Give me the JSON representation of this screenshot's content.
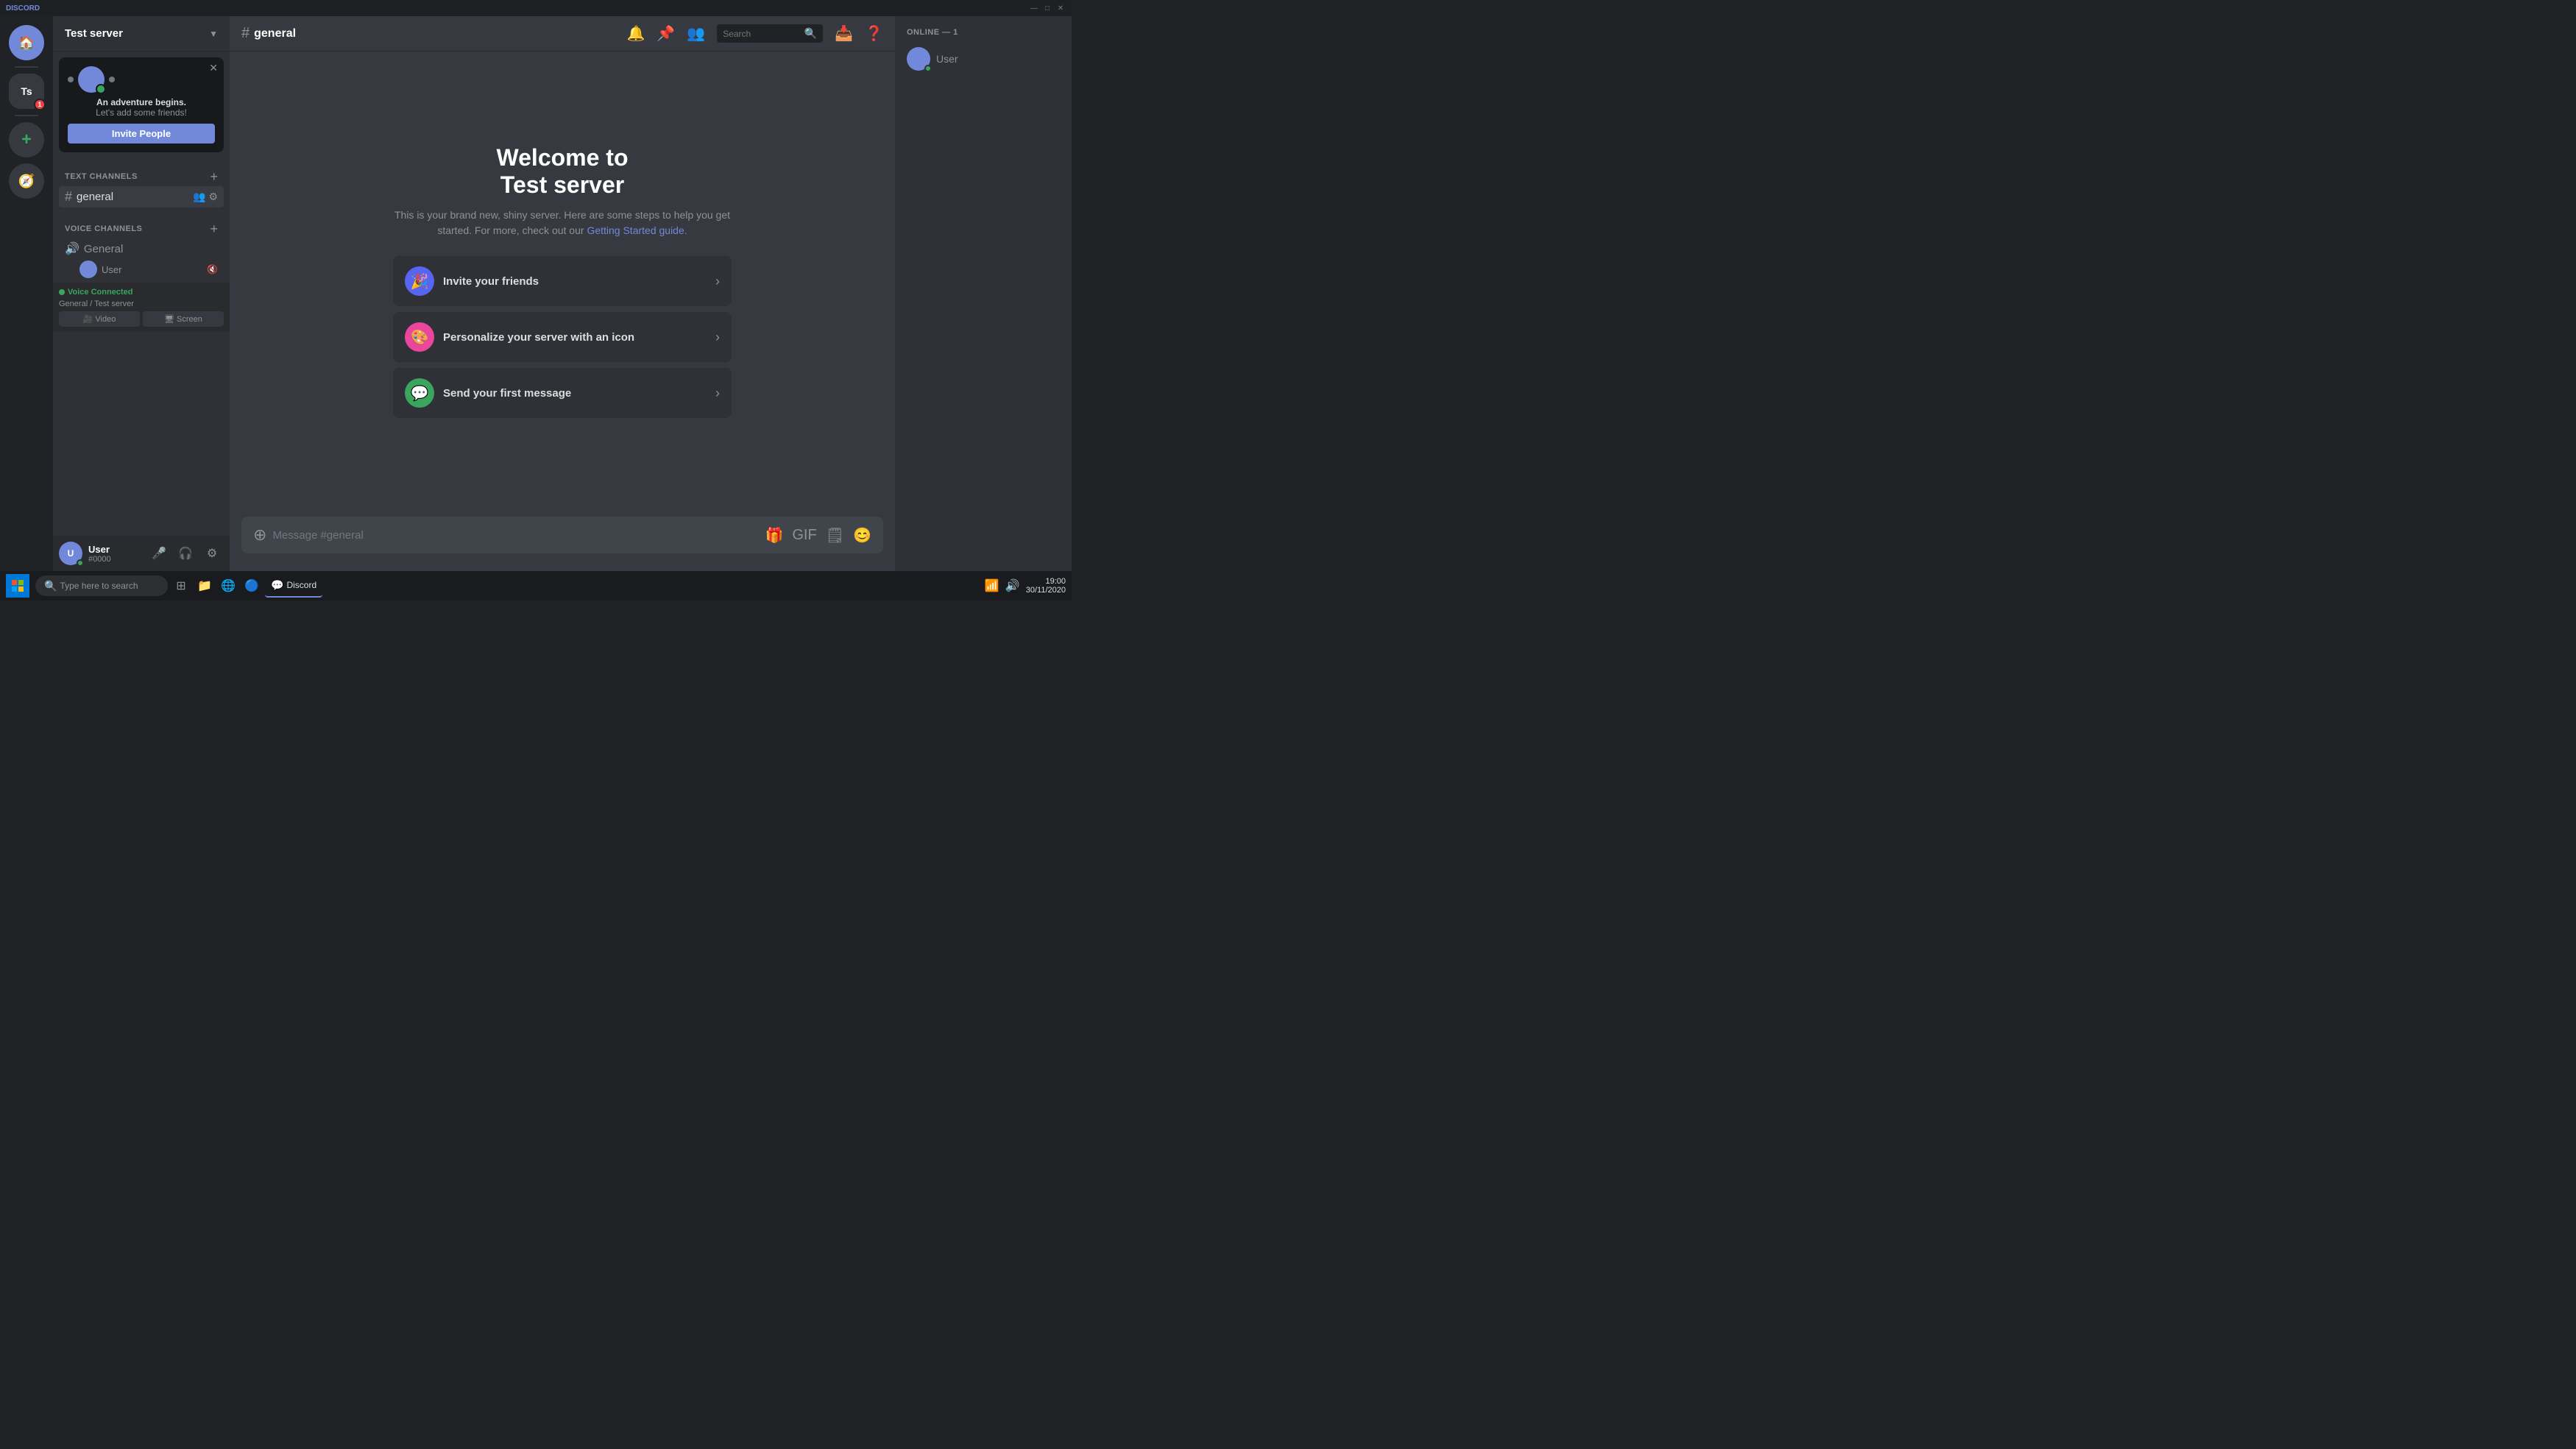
{
  "titleBar": {
    "title": "DISCORD",
    "controls": [
      "—",
      "□",
      "✕"
    ]
  },
  "serverList": {
    "servers": [
      {
        "id": "home",
        "label": "🏠",
        "type": "home",
        "tooltip": "Home"
      },
      {
        "id": "ts",
        "label": "Ts",
        "type": "ts",
        "tooltip": "Test server",
        "active": true
      }
    ],
    "addServer": "+",
    "exploreServers": "🧭"
  },
  "channelSidebar": {
    "serverName": "Test server",
    "popup": {
      "title": "An adventure begins.",
      "subtitle": "Let's add some friends!",
      "closeBtn": "✕",
      "inviteBtn": "Invite People"
    },
    "textChannelsLabel": "TEXT CHANNELS",
    "voiceChannelsLabel": "VOICE CHANNELS",
    "textChannels": [
      {
        "name": "general",
        "icon": "#",
        "active": true
      }
    ],
    "voiceChannels": [
      {
        "name": "General",
        "icon": "🔊"
      }
    ],
    "voiceMembers": [
      {
        "name": "User",
        "muted": false
      }
    ],
    "voiceConnected": {
      "status": "Voice Connected",
      "location": "General / Test server",
      "videoBtn": "Video",
      "screenBtn": "Screen"
    },
    "userPanel": {
      "username": "User",
      "tag": "#0000",
      "avatarInitials": "U"
    }
  },
  "topBar": {
    "channelIcon": "#",
    "channelName": "general",
    "searchPlaceholder": "Search"
  },
  "mainContent": {
    "welcomeTitle": "Welcome to",
    "welcomeServerName": "Test server",
    "welcomeDescription": "This is your brand new, shiny server. Here are some steps to help you get started. For more, check out our",
    "welcomeLink": "Getting Started guide.",
    "actionCards": [
      {
        "id": "invite-friends",
        "title": "Invite your friends",
        "iconBg": "#5865f2",
        "iconEmoji": "🎉"
      },
      {
        "id": "personalize-icon",
        "title": "Personalize your server with an icon",
        "iconBg": "#eb459e",
        "iconEmoji": "🎨"
      },
      {
        "id": "send-message",
        "title": "Send your first message",
        "iconBg": "#3ba55d",
        "iconEmoji": "💬"
      }
    ],
    "messagePlaceholder": "Message #general"
  },
  "membersSidebar": {
    "onlineLabel": "ONLINE — 1",
    "members": [
      {
        "name": "User",
        "status": "online"
      }
    ]
  },
  "taskbar": {
    "searchPlaceholder": "Type here to search",
    "time": "19:00",
    "date": "30/11/2020",
    "apps": [
      "Discord"
    ]
  }
}
